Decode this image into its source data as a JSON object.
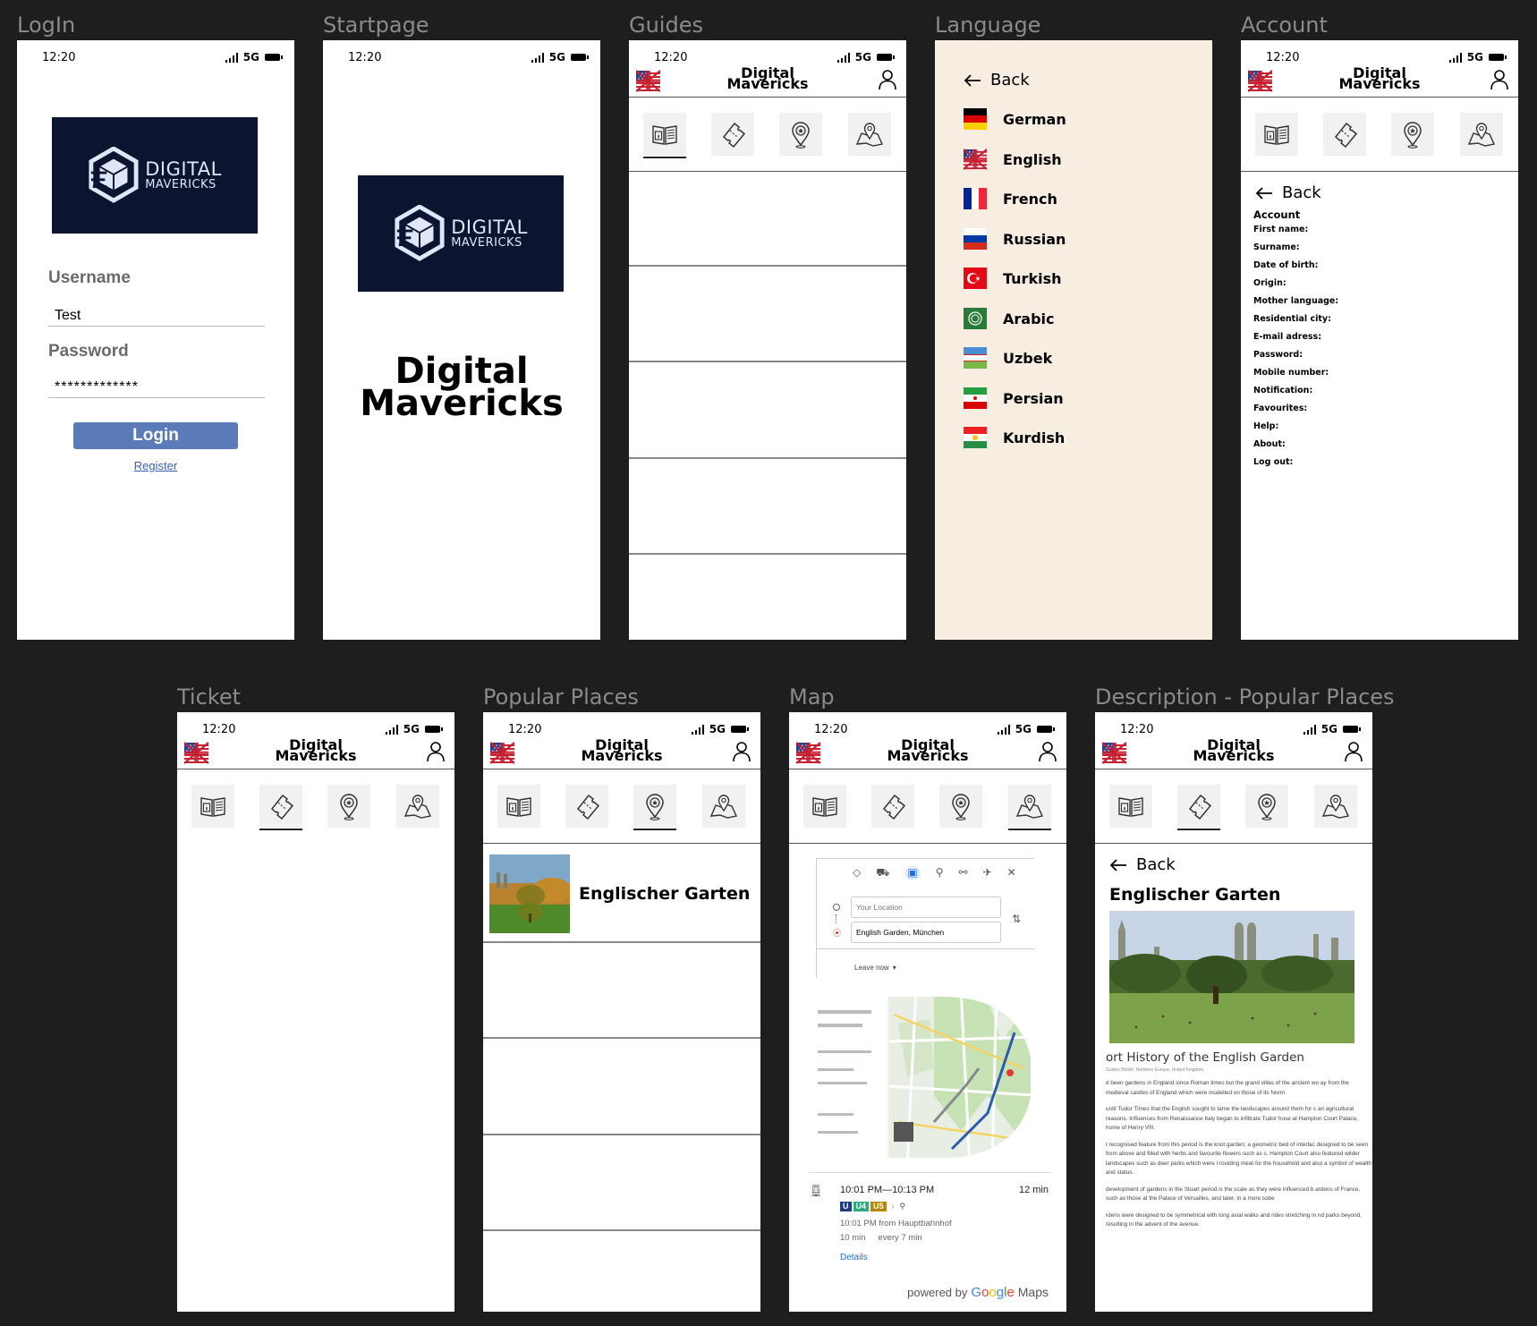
{
  "frames": {
    "login": "LogIn",
    "startpage": "Startpage",
    "guides": "Guides",
    "language": "Language",
    "account": "Account",
    "ticket": "Ticket",
    "popular": "Popular Places",
    "map": "Map",
    "description": "Description - Popular Places"
  },
  "status": {
    "time": "12:20",
    "network": "5G"
  },
  "app": {
    "title_line1": "Digital",
    "title_line2": "Mavericks"
  },
  "logo": {
    "line1": "DIGITAL",
    "line2": "MAVERICKS"
  },
  "login": {
    "username_label": "Username",
    "username_value": "Test",
    "password_label": "Password",
    "password_value": "*************",
    "login_button": "Login",
    "register_link": "Register"
  },
  "startpage": {
    "title_line1": "Digital",
    "title_line2": "Mavericks"
  },
  "back_label": "Back",
  "language": {
    "items": [
      "German",
      "English",
      "French",
      "Russian",
      "Turkish",
      "Arabic",
      "Uzbek",
      "Persian",
      "Kurdish"
    ]
  },
  "account": {
    "heading": "Account",
    "fields": [
      "First name:",
      "Surname:",
      "Date of birth:",
      "Origin:",
      "Mother language:",
      "Residential city:",
      "E-mail adress:",
      "Password:",
      "Mobile number:",
      "Notification:",
      "Favourites:",
      "Help:",
      "About:",
      "Log out:"
    ]
  },
  "popular": {
    "place_name": "Englischer Garten"
  },
  "map": {
    "origin_placeholder": "Your Location",
    "destination_value": "English Garden, München",
    "leave_now": "Leave now",
    "route_time": "10:01 PM—10:13 PM",
    "route_duration": "12 min",
    "line_u": "U",
    "line_u4": "U4",
    "line_u5": "U5",
    "route_from": "10:01 PM from Hauptbahnhof",
    "walk_time": "10 min",
    "frequency": "every 7 min",
    "details_link": "Details",
    "powered_by": "powered by",
    "google": "Google",
    "maps": "Maps",
    "brand_colors": {
      "blue": "#4285f4",
      "red": "#ea4335",
      "yellow": "#fbbc05",
      "green": "#34a853"
    }
  },
  "description": {
    "place_name": "Englischer Garten",
    "article_title": "ort History of the English Garden",
    "article_meta": "Guides  British, Northern Europe, United Kingdom",
    "paragraphs": [
      "d been gardens in England since Roman times but the grand villas of the ancient wo ay from the medieval castles of England which were modelled on those of its Norm",
      "until Tudor Times that the English sought to tame the landscapes around them for c an agricultural reasons. Influences from Renaissance Italy began to infiltrate Tudor hose at Hampton Court Palace, home of Henry VIII.",
      "t recognised feature from this period is the knot garden; a geometric bed of interlac designed to be seen from above and filled with herbs and favourite flowers such as s. Hampton Court also featured wilder landscapes such as deer parks which were l roviding meat for the household and also a symbol of wealth and status.",
      "development of gardens in the Stuart period is the scale as they were influenced b ardens of France, such as those at the Palace of Versailles, and later, in a more sobe",
      "rdens were designed to be symmetrical with long axial walks and rides stretching in nd parks beyond, resulting in the advent of the avenue."
    ]
  },
  "colors": {
    "background": "#1e1e1e",
    "navy": "#0c1530",
    "button_blue": "#5b7bb8",
    "language_bg": "#f8ede1"
  }
}
